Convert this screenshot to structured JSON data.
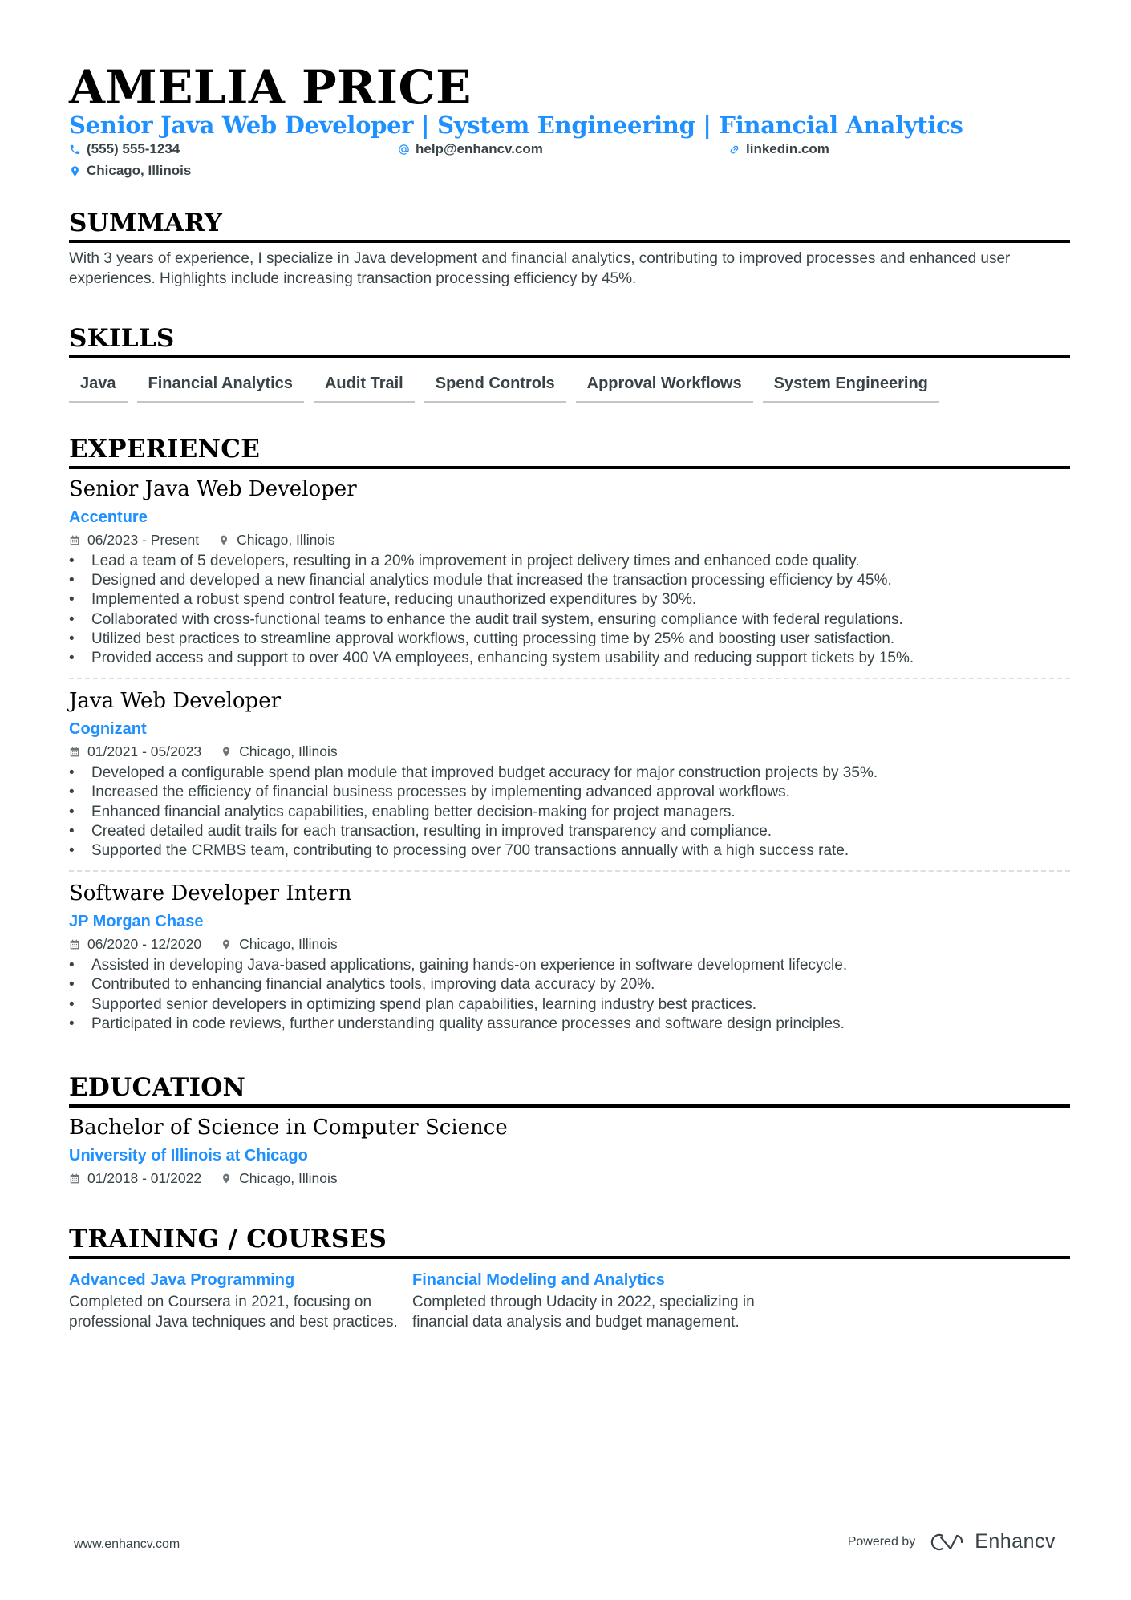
{
  "header": {
    "name": "AMELIA PRICE",
    "headline": "Senior Java Web Developer | System Engineering | Financial Analytics",
    "contacts": {
      "phone": {
        "icon": "phone-icon",
        "value": "(555) 555-1234"
      },
      "email": {
        "icon": "at-icon",
        "value": "help@enhancv.com"
      },
      "website": {
        "icon": "link-icon",
        "value": "linkedin.com"
      },
      "location": {
        "icon": "location-pin-icon",
        "value": "Chicago, Illinois"
      }
    }
  },
  "colors": {
    "accent": "#1e90ff",
    "text": "#384347",
    "heading": "#000000"
  },
  "summary": {
    "title": "SUMMARY",
    "text": "With 3 years of experience, I specialize in Java development and financial analytics, contributing to improved processes and enhanced user experiences. Highlights include increasing transaction processing efficiency by 45%."
  },
  "skills": {
    "title": "SKILLS",
    "items": [
      "Java",
      "Financial Analytics",
      "Audit Trail",
      "Spend Controls",
      "Approval Workflows",
      "System Engineering"
    ]
  },
  "experience": {
    "title": "EXPERIENCE",
    "jobs": [
      {
        "title": "Senior Java Web Developer",
        "company": "Accenture",
        "dates": "06/2023 - Present",
        "location": "Chicago, Illinois",
        "bullets": [
          "Lead a team of 5 developers, resulting in a 20% improvement in project delivery times and enhanced code quality.",
          "Designed and developed a new financial analytics module that increased the transaction processing efficiency by 45%.",
          "Implemented a robust spend control feature, reducing unauthorized expenditures by 30%.",
          "Collaborated with cross-functional teams to enhance the audit trail system, ensuring compliance with federal regulations.",
          "Utilized best practices to streamline approval workflows, cutting processing time by 25% and boosting user satisfaction.",
          "Provided access and support to over 400 VA employees, enhancing system usability and reducing support tickets by 15%."
        ]
      },
      {
        "title": "Java Web Developer",
        "company": "Cognizant",
        "dates": "01/2021 - 05/2023",
        "location": "Chicago, Illinois",
        "bullets": [
          "Developed a configurable spend plan module that improved budget accuracy for major construction projects by 35%.",
          "Increased the efficiency of financial business processes by implementing advanced approval workflows.",
          "Enhanced financial analytics capabilities, enabling better decision-making for project managers.",
          "Created detailed audit trails for each transaction, resulting in improved transparency and compliance.",
          "Supported the CRMBS team, contributing to processing over 700 transactions annually with a high success rate."
        ]
      },
      {
        "title": "Software Developer Intern",
        "company": "JP Morgan Chase",
        "dates": "06/2020 - 12/2020",
        "location": "Chicago, Illinois",
        "bullets": [
          "Assisted in developing Java-based applications, gaining hands-on experience in software development lifecycle.",
          "Contributed to enhancing financial analytics tools, improving data accuracy by 20%.",
          "Supported senior developers in optimizing spend plan capabilities, learning industry best practices.",
          "Participated in code reviews, further understanding quality assurance processes and software design principles."
        ]
      }
    ]
  },
  "education": {
    "title": "EDUCATION",
    "entries": [
      {
        "degree": "Bachelor of Science in Computer Science",
        "school": "University of Illinois at Chicago",
        "dates": "01/2018 - 01/2022",
        "location": "Chicago, Illinois"
      }
    ]
  },
  "training": {
    "title": "TRAINING / COURSES",
    "items": [
      {
        "title": "Advanced Java Programming",
        "description": "Completed on Coursera in 2021, focusing on professional Java techniques and best practices."
      },
      {
        "title": "Financial Modeling and Analytics",
        "description": "Completed through Udacity in 2022, specializing in financial data analysis and budget management."
      }
    ]
  },
  "footer": {
    "website": "www.enhancv.com",
    "powered_by": "Powered by",
    "brand": "Enhancv",
    "brand_icon": "enhancv-logo-icon"
  }
}
